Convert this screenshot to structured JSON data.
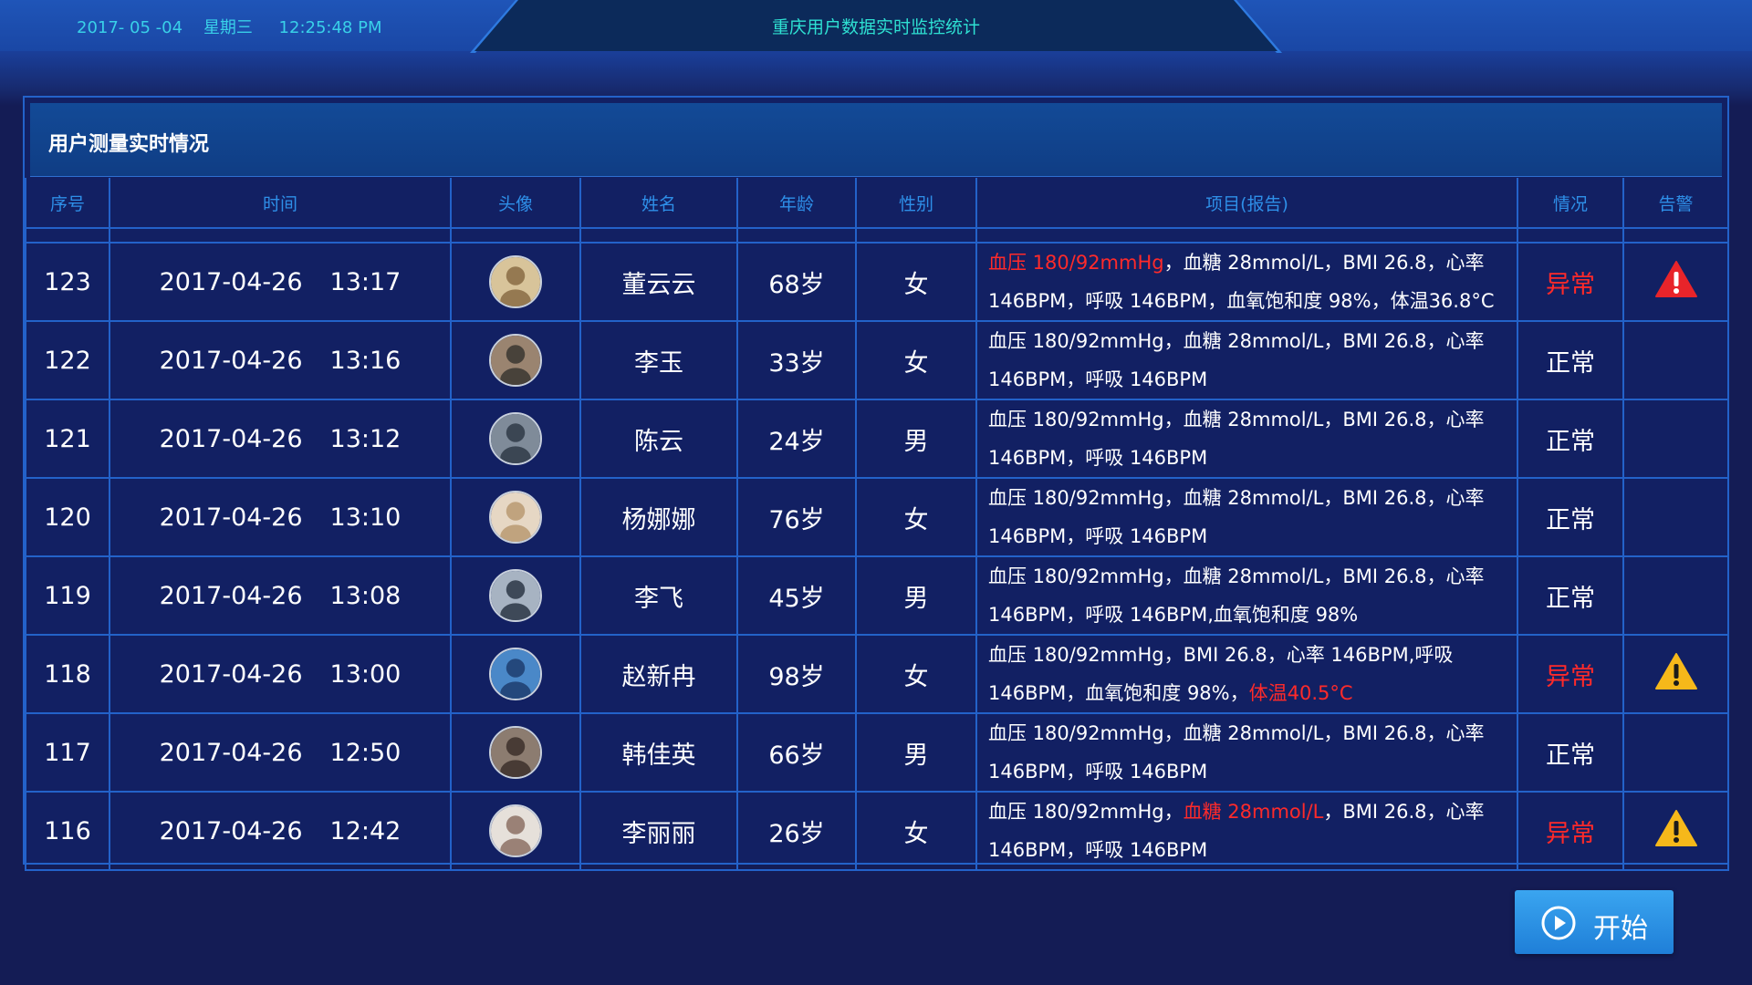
{
  "header": {
    "datetime": "2017- 05 -04    星期三     12:25:48 PM",
    "title": "重庆用户数据实时监控统计"
  },
  "panel": {
    "title": "用户测量实时情况"
  },
  "table": {
    "columns": [
      "序号",
      "时间",
      "头像",
      "姓名",
      "年龄",
      "性别",
      "项目(报告)",
      "情况",
      "告警"
    ],
    "rows": [
      {
        "id": "123",
        "date": "2017-04-26",
        "time": "13:17",
        "name": "董云云",
        "age": "68岁",
        "gender": "女",
        "report": [
          {
            "text": "血压 180/92mmHg",
            "red": true
          },
          {
            "text": "，血糖 28mmol/L，BMI 26.8，心率 146BPM，呼吸 146BPM，血氧饱和度 98%，体温36.8°C",
            "red": false
          }
        ],
        "status": "异常",
        "status_abnormal": true,
        "alert": "red-warning-icon"
      },
      {
        "id": "122",
        "date": "2017-04-26",
        "time": "13:16",
        "name": "李玉",
        "age": "33岁",
        "gender": "女",
        "report": [
          {
            "text": "血压 180/92mmHg，血糖 28mmol/L，BMI 26.8，心率 146BPM，呼吸 146BPM",
            "red": false
          }
        ],
        "status": "正常",
        "status_abnormal": false,
        "alert": ""
      },
      {
        "id": "121",
        "date": "2017-04-26",
        "time": "13:12",
        "name": "陈云",
        "age": "24岁",
        "gender": "男",
        "report": [
          {
            "text": "血压 180/92mmHg，血糖 28mmol/L，BMI 26.8，心率 146BPM，呼吸 146BPM",
            "red": false
          }
        ],
        "status": "正常",
        "status_abnormal": false,
        "alert": ""
      },
      {
        "id": "120",
        "date": "2017-04-26",
        "time": "13:10",
        "name": "杨娜娜",
        "age": "76岁",
        "gender": "女",
        "report": [
          {
            "text": "血压 180/92mmHg，血糖 28mmol/L，BMI 26.8，心率 146BPM，呼吸 146BPM",
            "red": false
          }
        ],
        "status": "正常",
        "status_abnormal": false,
        "alert": ""
      },
      {
        "id": "119",
        "date": "2017-04-26",
        "time": "13:08",
        "name": "李飞",
        "age": "45岁",
        "gender": "男",
        "report": [
          {
            "text": "血压 180/92mmHg，血糖 28mmol/L，BMI 26.8，心率 146BPM，呼吸 146BPM,血氧饱和度 98%",
            "red": false
          }
        ],
        "status": "正常",
        "status_abnormal": false,
        "alert": ""
      },
      {
        "id": "118",
        "date": "2017-04-26",
        "time": "13:00",
        "name": "赵新冉",
        "age": "98岁",
        "gender": "女",
        "report": [
          {
            "text": "血压 180/92mmHg，BMI 26.8，心率 146BPM,呼吸 146BPM，血氧饱和度 98%，",
            "red": false
          },
          {
            "text": "体温40.5°C",
            "red": true
          }
        ],
        "status": "异常",
        "status_abnormal": true,
        "alert": "yellow-warning-icon"
      },
      {
        "id": "117",
        "date": "2017-04-26",
        "time": "12:50",
        "name": "韩佳英",
        "age": "66岁",
        "gender": "男",
        "report": [
          {
            "text": "血压 180/92mmHg，血糖 28mmol/L，BMI 26.8，心率 146BPM，呼吸 146BPM",
            "red": false
          }
        ],
        "status": "正常",
        "status_abnormal": false,
        "alert": ""
      },
      {
        "id": "116",
        "date": "2017-04-26",
        "time": "12:42",
        "name": "李丽丽",
        "age": "26岁",
        "gender": "女",
        "report": [
          {
            "text": "血压 180/92mmHg，",
            "red": false
          },
          {
            "text": "血糖 28mmol/L",
            "red": true
          },
          {
            "text": "，BMI 26.8，心率 146BPM，呼吸 146BPM",
            "red": false
          }
        ],
        "status": "异常",
        "status_abnormal": true,
        "alert": "yellow-warning-icon"
      }
    ]
  },
  "start_button": {
    "label": "开始",
    "icon": "play-circle-icon"
  },
  "colors": {
    "abnormal": "#ff2a2a",
    "header_text": "#2e8fe8",
    "title_text": "#2ee0d2",
    "warning_red": "#e8242a",
    "warning_yellow": "#f6b81a"
  }
}
